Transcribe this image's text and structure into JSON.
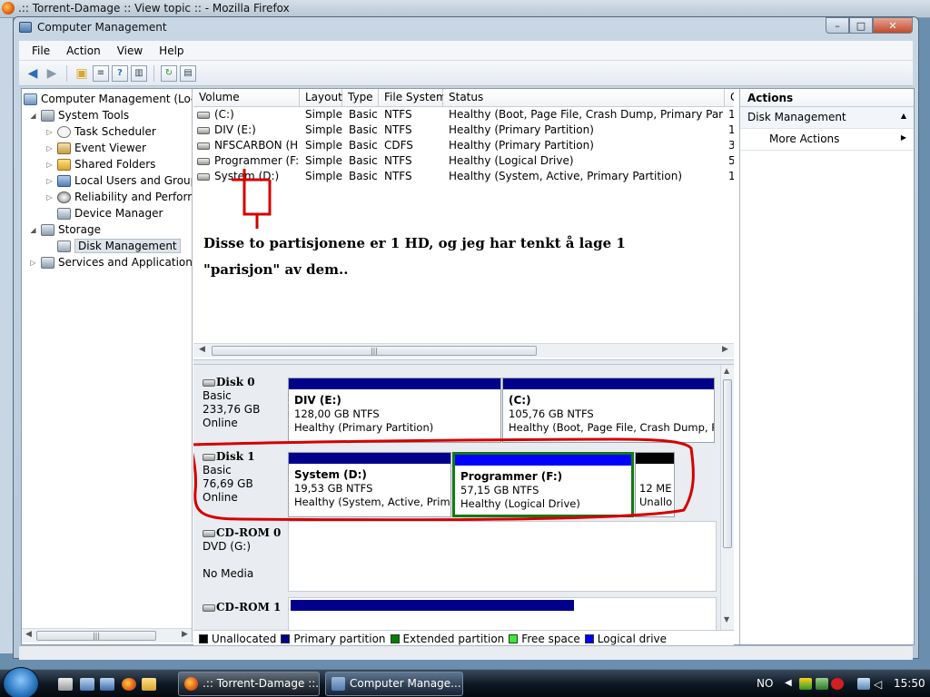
{
  "firefox": {
    "title": ".:: Torrent-Damage :: View topic :: - Mozilla Firefox"
  },
  "window": {
    "title": "Computer Management",
    "min_glyph": "–",
    "max_glyph": "□",
    "close_glyph": "✕"
  },
  "menu": {
    "items": [
      "File",
      "Action",
      "View",
      "Help"
    ]
  },
  "tree": {
    "root": "Computer Management (Local",
    "system_tools": "System Tools",
    "task_scheduler": "Task Scheduler",
    "event_viewer": "Event Viewer",
    "shared_folders": "Shared Folders",
    "local_users": "Local Users and Groups",
    "reliability": "Reliability and Performa",
    "device_manager": "Device Manager",
    "storage": "Storage",
    "disk_management": "Disk Management",
    "services": "Services and Applications"
  },
  "volume_table": {
    "columns": [
      "Volume",
      "Layout",
      "Type",
      "File System",
      "Status",
      "C"
    ],
    "rows": [
      {
        "volume": "(C:)",
        "layout": "Simple",
        "type": "Basic",
        "fs": "NTFS",
        "status": "Healthy (Boot, Page File, Crash Dump, Primary Partition)",
        "cap": "1"
      },
      {
        "volume": "DIV (E:)",
        "layout": "Simple",
        "type": "Basic",
        "fs": "NTFS",
        "status": "Healthy (Primary Partition)",
        "cap": "1"
      },
      {
        "volume": "NFSCARBON (H:)",
        "layout": "Simple",
        "type": "Basic",
        "fs": "CDFS",
        "status": "Healthy (Primary Partition)",
        "cap": "3"
      },
      {
        "volume": "Programmer (F:)",
        "layout": "Simple",
        "type": "Basic",
        "fs": "NTFS",
        "status": "Healthy (Logical Drive)",
        "cap": "5"
      },
      {
        "volume": "System (D:)",
        "layout": "Simple",
        "type": "Basic",
        "fs": "NTFS",
        "status": "Healthy (System, Active, Primary Partition)",
        "cap": "1"
      }
    ]
  },
  "annotation": {
    "text": "Disse to partisjonene er 1 HD, og jeg har tenkt å lage 1 \"parisjon\" av dem.."
  },
  "disks": [
    {
      "name": "Disk 0",
      "type": "Basic",
      "size": "233,76 GB",
      "state": "Online",
      "partitions": [
        {
          "title": "DIV  (E:)",
          "size": "128,00 GB NTFS",
          "status": "Healthy (Primary Partition)"
        },
        {
          "title": "(C:)",
          "size": "105,76 GB NTFS",
          "status": "Healthy (Boot, Page File, Crash Dump, Pri"
        }
      ]
    },
    {
      "name": "Disk 1",
      "type": "Basic",
      "size": "76,69 GB",
      "state": "Online",
      "partitions": [
        {
          "title": "System  (D:)",
          "size": "19,53 GB NTFS",
          "status": "Healthy (System, Active, Primar"
        },
        {
          "title": "Programmer  (F:)",
          "size": "57,15 GB NTFS",
          "status": "Healthy (Logical Drive)"
        },
        {
          "title": "",
          "size": "12 ME",
          "status": "Unallo"
        }
      ]
    },
    {
      "name": "CD-ROM 0",
      "type": "DVD (G:)",
      "size": "",
      "state": "No Media"
    },
    {
      "name": "CD-ROM 1"
    }
  ],
  "legend": [
    "Unallocated",
    "Primary partition",
    "Extended partition",
    "Free space",
    "Logical drive"
  ],
  "colors": {
    "unallocated": "#000000",
    "primary": "#00008b",
    "extended": "#008000",
    "free": "#33ee33",
    "logical": "#0000ff",
    "annotation_ink": "#d40000"
  },
  "actions": {
    "header": "Actions",
    "section": "Disk Management",
    "more": "More Actions"
  },
  "taskbar": {
    "tasks": [
      ".:: Torrent-Damage ::...",
      "Computer Manage..."
    ],
    "lang": "NO",
    "clock": "15:50"
  }
}
